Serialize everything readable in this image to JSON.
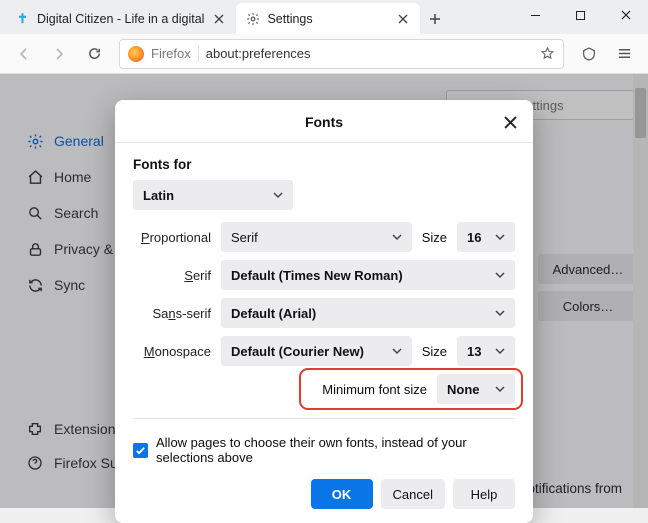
{
  "tabs": [
    {
      "label": "Digital Citizen - Life in a digital",
      "icon": "cross-blue"
    },
    {
      "label": "Settings",
      "icon": "gear"
    }
  ],
  "url": {
    "identity": "Firefox",
    "value": "about:preferences"
  },
  "sidebar": {
    "items": [
      {
        "icon": "gear",
        "label": "General"
      },
      {
        "icon": "home",
        "label": "Home"
      },
      {
        "icon": "search",
        "label": "Search"
      },
      {
        "icon": "lock",
        "label": "Privacy & Security"
      },
      {
        "icon": "sync",
        "label": "Sync"
      }
    ],
    "foot": [
      {
        "icon": "puzzle",
        "label": "Extensions & Themes"
      },
      {
        "icon": "help",
        "label": "Firefox Support"
      }
    ]
  },
  "search_placeholder": "Find in Settings",
  "right_buttons": [
    "Advanced…",
    "Colors…"
  ],
  "body_text": "Choose the languages used to display menus, messages, and notifications from",
  "modal": {
    "title": "Fonts",
    "fonts_for_label": "Fonts for",
    "script": "Latin",
    "rows": {
      "proportional": {
        "label": "Proportional",
        "value": "Serif",
        "size_label": "Size",
        "size": "16"
      },
      "serif": {
        "label": "Serif",
        "value": "Default (Times New Roman)"
      },
      "sans": {
        "label": "Sans-serif",
        "value": "Default (Arial)"
      },
      "mono": {
        "label": "Monospace",
        "value": "Default (Courier New)",
        "size_label": "Size",
        "size": "13"
      }
    },
    "min": {
      "label": "Minimum font size",
      "value": "None"
    },
    "checkbox": "Allow pages to choose their own fonts, instead of your selections above",
    "buttons": {
      "ok": "OK",
      "cancel": "Cancel",
      "help": "Help"
    }
  }
}
